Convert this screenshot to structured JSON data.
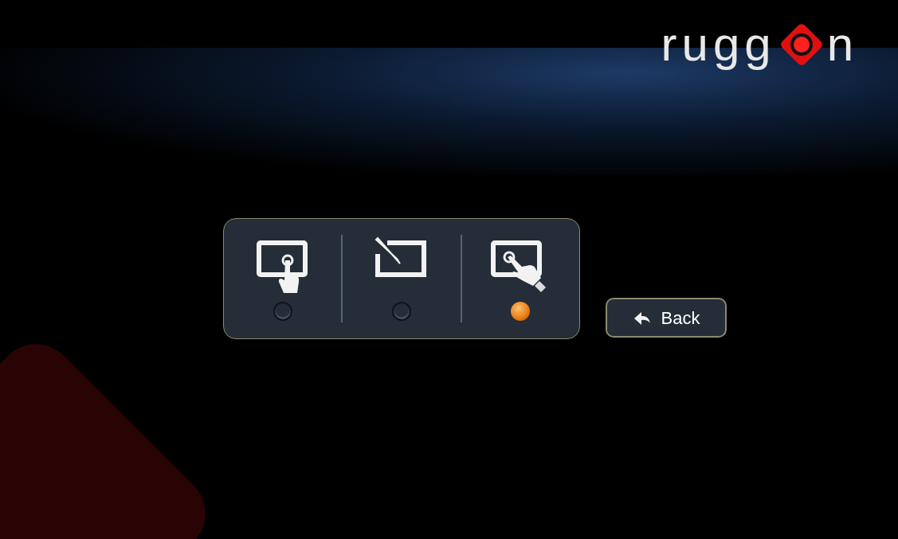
{
  "logo": {
    "text_left": "rugg",
    "text_right": "n"
  },
  "modes": [
    {
      "kind": "finger",
      "selected": false
    },
    {
      "kind": "pen",
      "selected": false
    },
    {
      "kind": "glove",
      "selected": true
    }
  ],
  "back_button": {
    "label": "Back"
  }
}
